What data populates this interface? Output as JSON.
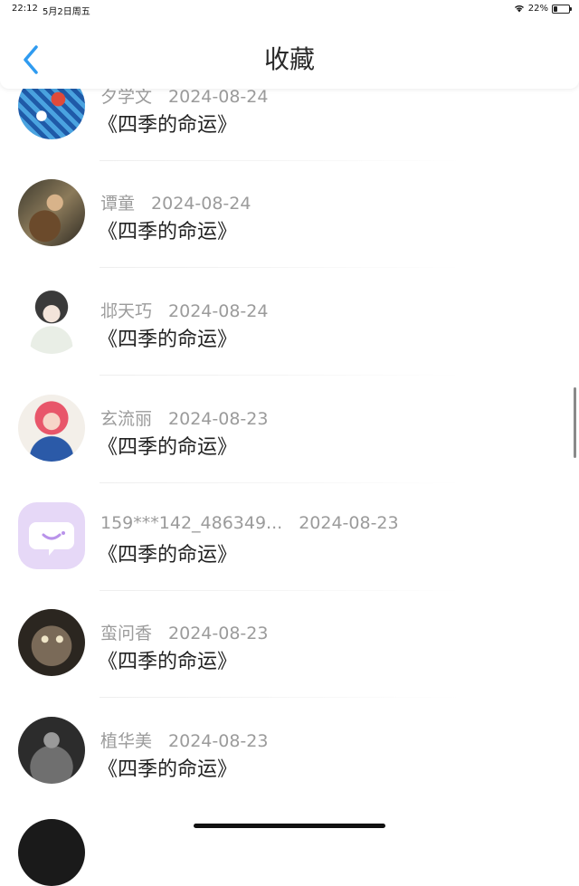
{
  "status_bar": {
    "time": "22:12",
    "date": "5月2日周五",
    "battery": "22%",
    "battery_level": 0.22
  },
  "header": {
    "title": "收藏"
  },
  "colors": {
    "accent": "#2f9bf0",
    "meta_text": "#9b9b9b"
  },
  "items": [
    {
      "name": "夕学文",
      "date": "2024-08-24",
      "book": "《四季的命运》"
    },
    {
      "name": "谭童",
      "date": "2024-08-24",
      "book": "《四季的命运》"
    },
    {
      "name": "邶天巧",
      "date": "2024-08-24",
      "book": "《四季的命运》"
    },
    {
      "name": "玄流丽",
      "date": "2024-08-23",
      "book": "《四季的命运》"
    },
    {
      "name": "159***142_486349...",
      "date": "2024-08-23",
      "book": "《四季的命运》"
    },
    {
      "name": "蛮问香",
      "date": "2024-08-23",
      "book": "《四季的命运》"
    },
    {
      "name": "植华美",
      "date": "2024-08-23",
      "book": "《四季的命运》"
    }
  ]
}
